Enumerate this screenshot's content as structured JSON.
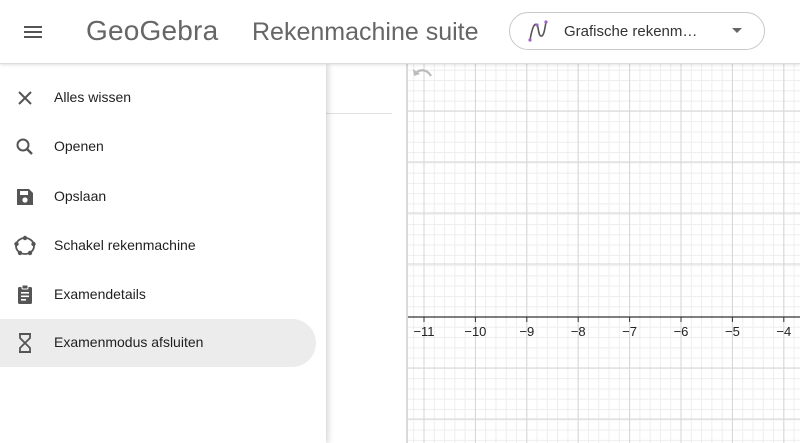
{
  "header": {
    "logo_text": "GeoGebra",
    "app_title": "Rekenmachine suite",
    "calc_switcher_label": "Grafische rekenm…"
  },
  "menu": {
    "items": [
      {
        "label": "Alles wissen",
        "icon": "close-icon",
        "active": false
      },
      {
        "label": "Openen",
        "icon": "search-icon",
        "active": false
      },
      {
        "label": "Opslaan",
        "icon": "save-icon",
        "active": false
      },
      {
        "label": "Schakel rekenmachine",
        "icon": "switch-calculator-icon",
        "active": false
      },
      {
        "label": "Examendetails",
        "icon": "clipboard-icon",
        "active": false
      },
      {
        "label": "Examenmodus afsluiten",
        "icon": "hourglass-icon",
        "active": true
      }
    ]
  },
  "graphics": {
    "x_ticks": [
      "−11",
      "−10",
      "−9",
      "−8",
      "−7",
      "−6",
      "−5",
      "−4"
    ],
    "colors": {
      "grid_major": "#d6d6d6",
      "grid_minor": "#eeeeee",
      "axis": "#333333"
    }
  }
}
